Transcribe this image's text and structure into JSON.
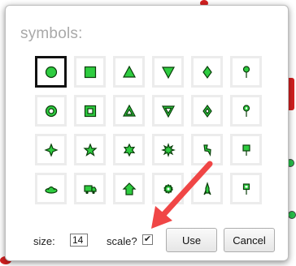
{
  "dialog": {
    "title": "symbols:",
    "selected_index": 0,
    "symbols": [
      {
        "icon": "circle-icon"
      },
      {
        "icon": "square-icon"
      },
      {
        "icon": "triangle-icon"
      },
      {
        "icon": "triangle-down-icon"
      },
      {
        "icon": "diamond-icon"
      },
      {
        "icon": "pin-icon"
      },
      {
        "icon": "circle-in-circle-icon"
      },
      {
        "icon": "square-in-square-icon"
      },
      {
        "icon": "triangle-in-triangle-icon"
      },
      {
        "icon": "triangle-down-in-triangle-icon"
      },
      {
        "icon": "diamond-in-diamond-icon"
      },
      {
        "icon": "pin-outline-icon"
      },
      {
        "icon": "star4-icon"
      },
      {
        "icon": "star5-icon"
      },
      {
        "icon": "star6-icon"
      },
      {
        "icon": "star8-icon"
      },
      {
        "icon": "lightning-icon"
      },
      {
        "icon": "flag-icon"
      },
      {
        "icon": "ufo-icon"
      },
      {
        "icon": "truck-icon"
      },
      {
        "icon": "house-icon"
      },
      {
        "icon": "gear-icon"
      },
      {
        "icon": "rocket-icon"
      },
      {
        "icon": "flag-small-icon"
      }
    ],
    "size_label": "size:",
    "size_value": "14",
    "scale_label": "scale?",
    "scale_checked": true,
    "checkmark": "✔",
    "use_label": "Use",
    "cancel_label": "Cancel"
  },
  "colors": {
    "symbol_fill": "#2ecc40",
    "symbol_stroke": "#0a3d0a",
    "arrow": "#f04646"
  }
}
